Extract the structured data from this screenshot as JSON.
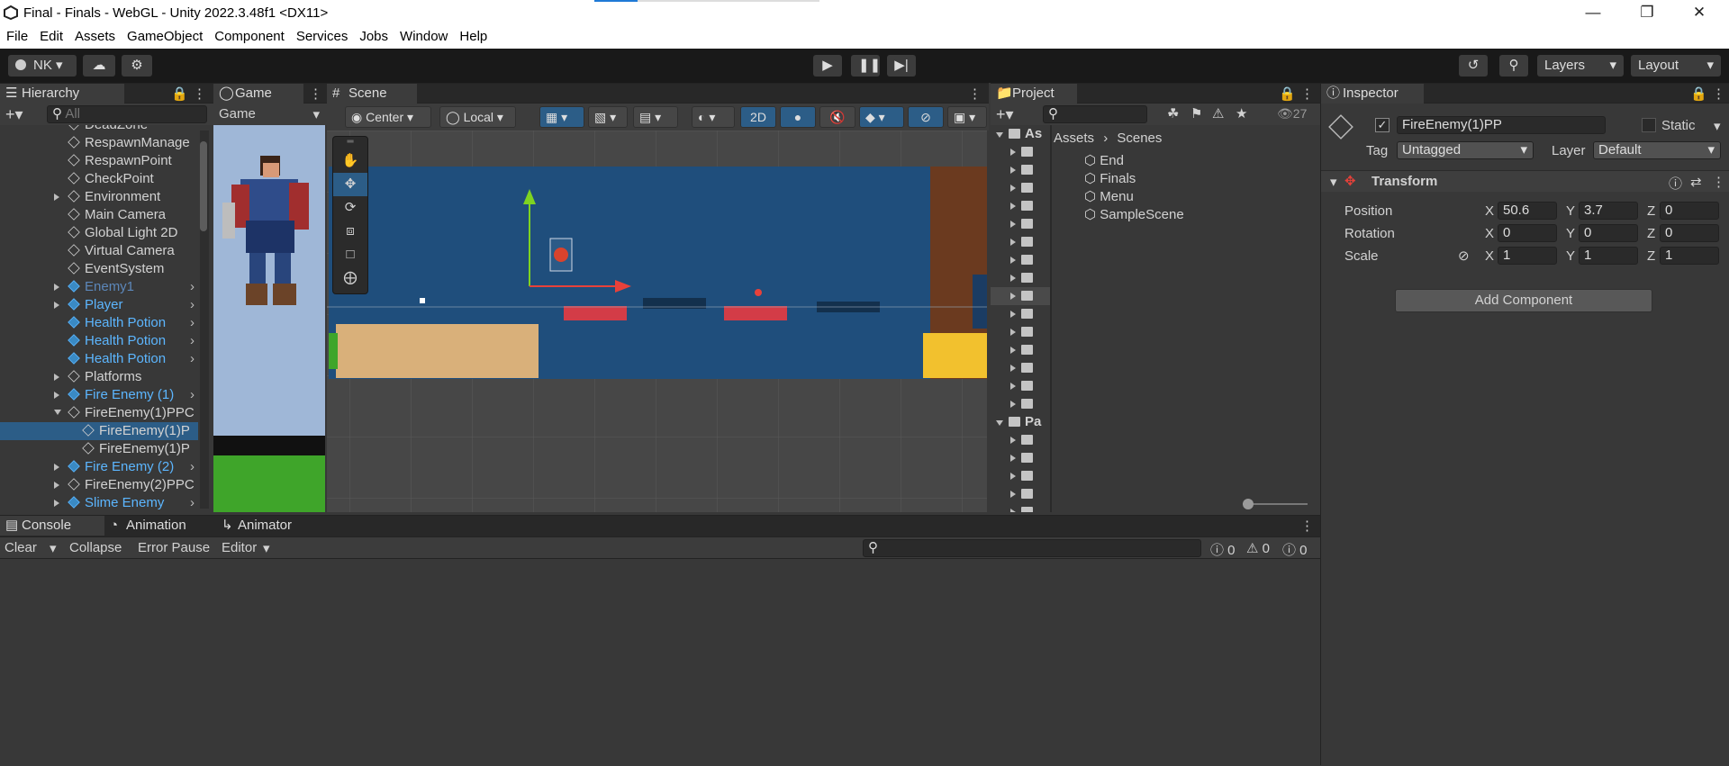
{
  "window": {
    "title": "Final - Finals - WebGL - Unity 2022.3.48f1 <DX11>"
  },
  "menu": [
    "File",
    "Edit",
    "Assets",
    "GameObject",
    "Component",
    "Services",
    "Jobs",
    "Window",
    "Help"
  ],
  "toolbar": {
    "account": "NK",
    "layers": "Layers",
    "layout": "Layout"
  },
  "hierarchy": {
    "tab": "Hierarchy",
    "search_placeholder": "All",
    "items": [
      {
        "label": "DeadZone",
        "style": "white",
        "indent": 1,
        "arrow": "none",
        "prefab": false
      },
      {
        "label": "RespawnManage",
        "style": "white",
        "indent": 1,
        "arrow": "none",
        "prefab": false
      },
      {
        "label": "RespawnPoint",
        "style": "white",
        "indent": 1,
        "arrow": "none",
        "prefab": false
      },
      {
        "label": "CheckPoint",
        "style": "white",
        "indent": 1,
        "arrow": "none",
        "prefab": false
      },
      {
        "label": "Environment",
        "style": "white",
        "indent": 1,
        "arrow": "right",
        "prefab": false
      },
      {
        "label": "Main Camera",
        "style": "white",
        "indent": 1,
        "arrow": "none",
        "prefab": false
      },
      {
        "label": "Global Light 2D",
        "style": "white",
        "indent": 1,
        "arrow": "none",
        "prefab": false
      },
      {
        "label": "Virtual Camera",
        "style": "white",
        "indent": 1,
        "arrow": "none",
        "prefab": false
      },
      {
        "label": "EventSystem",
        "style": "white",
        "indent": 1,
        "arrow": "none",
        "prefab": false
      },
      {
        "label": "Enemy1",
        "style": "dim",
        "indent": 1,
        "arrow": "right",
        "prefab": true
      },
      {
        "label": "Player",
        "style": "blue",
        "indent": 1,
        "arrow": "right",
        "prefab": true
      },
      {
        "label": "Health Potion",
        "style": "blue",
        "indent": 1,
        "arrow": "none",
        "prefab": true
      },
      {
        "label": "Health Potion",
        "style": "blue",
        "indent": 1,
        "arrow": "none",
        "prefab": true
      },
      {
        "label": "Health Potion",
        "style": "blue",
        "indent": 1,
        "arrow": "none",
        "prefab": true
      },
      {
        "label": "Platforms",
        "style": "white",
        "indent": 1,
        "arrow": "right",
        "prefab": false
      },
      {
        "label": "Fire Enemy (1)",
        "style": "blue",
        "indent": 1,
        "arrow": "right",
        "prefab": true
      },
      {
        "label": "FireEnemy(1)PPC",
        "style": "white",
        "indent": 1,
        "arrow": "down",
        "prefab": false
      },
      {
        "label": "FireEnemy(1)P",
        "style": "white",
        "indent": 2,
        "arrow": "none",
        "prefab": false
      },
      {
        "label": "FireEnemy(1)P",
        "style": "white",
        "indent": 2,
        "arrow": "none",
        "prefab": false
      },
      {
        "label": "Fire Enemy (2)",
        "style": "blue",
        "indent": 1,
        "arrow": "right",
        "prefab": true
      },
      {
        "label": "FireEnemy(2)PPC",
        "style": "white",
        "indent": 1,
        "arrow": "right",
        "prefab": false
      },
      {
        "label": "Slime Enemy",
        "style": "blue",
        "indent": 1,
        "arrow": "right",
        "prefab": true
      }
    ],
    "selected_index": 17
  },
  "game": {
    "tab": "Game",
    "display": "Game"
  },
  "scene": {
    "tab": "Scene",
    "pivot": "Center",
    "space": "Local",
    "mode2d": "2D"
  },
  "project": {
    "tab": "Project",
    "count": "27",
    "breadcrumb": [
      "Assets",
      "Scenes"
    ],
    "tree_top": "As",
    "tree_mid": "Pa",
    "scenes": [
      "End",
      "Finals",
      "Menu",
      "SampleScene"
    ]
  },
  "inspector": {
    "tab": "Inspector",
    "name": "FireEnemy(1)PP",
    "static": "Static",
    "tag_label": "Tag",
    "tag": "Untagged",
    "layer_label": "Layer",
    "layer": "Default",
    "component": "Transform",
    "rows": [
      {
        "label": "Position",
        "x": "50.6",
        "y": "3.7",
        "z": "0"
      },
      {
        "label": "Rotation",
        "x": "0",
        "y": "0",
        "z": "0"
      },
      {
        "label": "Scale",
        "x": "1",
        "y": "1",
        "z": "1"
      }
    ],
    "add_component": "Add Component"
  },
  "console": {
    "tabs": [
      "Console",
      "Animation",
      "Animator"
    ],
    "clear": "Clear",
    "collapse": "Collapse",
    "error_pause": "Error Pause",
    "editor": "Editor",
    "log_count": "0",
    "warn_count": "0",
    "error_count": "0"
  }
}
